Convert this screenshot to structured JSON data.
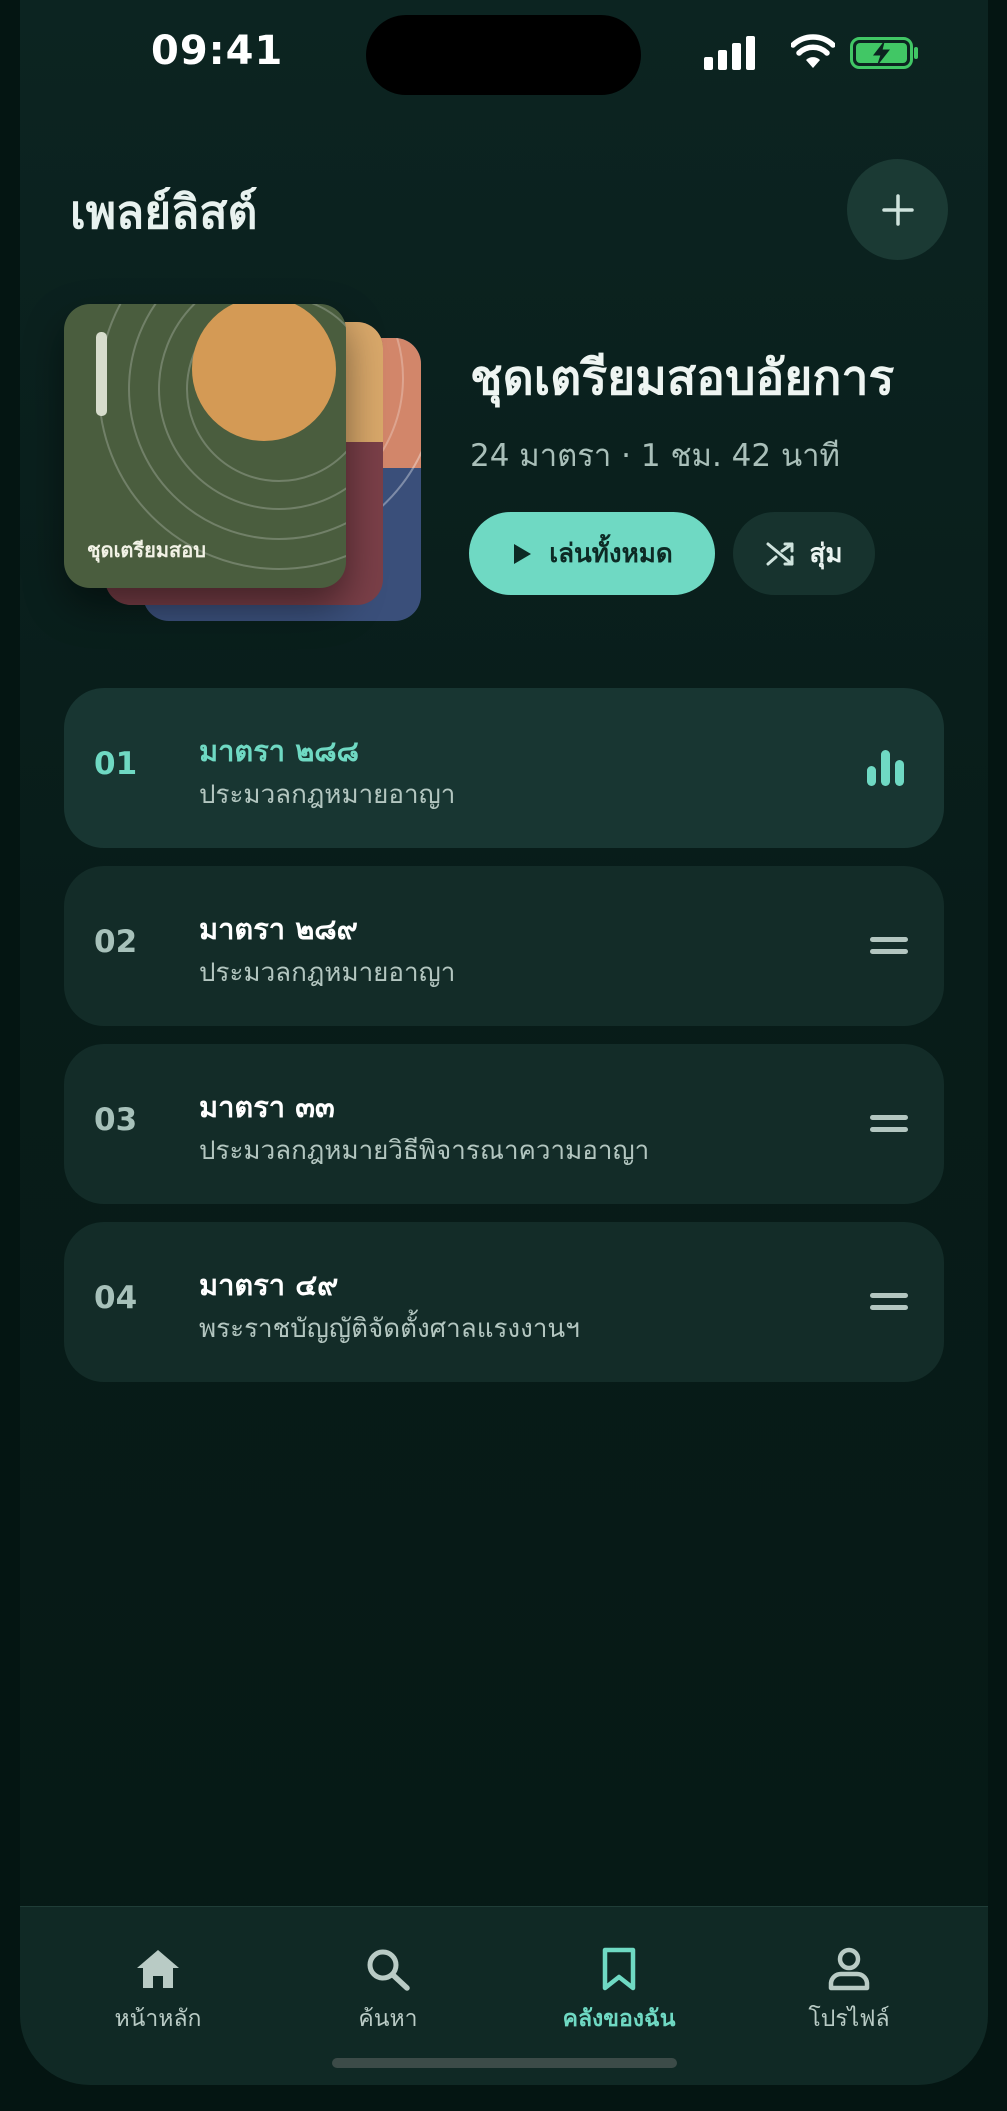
{
  "status_bar": {
    "time": "09:41",
    "icons": [
      "signal-icon",
      "wifi-icon",
      "battery-charging-icon"
    ]
  },
  "header": {
    "title": "เพลย์ลิสต์",
    "add_icon": "plus-icon"
  },
  "playlist": {
    "cover_label": "ชุดเตรียมสอบ",
    "name": "ชุดเตรียมสอบอัยการ",
    "meta": "24 มาตรา · 1 ชม. 42 นาที",
    "play_all_label": "เล่นทั้งหมด",
    "shuffle_label": "สุ่ม"
  },
  "tracks": [
    {
      "number": "01",
      "title": "มาตรา ๒๘๘",
      "subtitle": "ประมวลกฎหมายอาญา",
      "state": "playing"
    },
    {
      "number": "02",
      "title": "มาตรา ๒๘๙",
      "subtitle": "ประมวลกฎหมายอาญา",
      "state": "idle"
    },
    {
      "number": "03",
      "title": "มาตรา ๓๓",
      "subtitle": "ประมวลกฎหมายวิธีพิจารณาความอาญา",
      "state": "idle"
    },
    {
      "number": "04",
      "title": "มาตรา ๔๙",
      "subtitle": "พระราชบัญญัติจัดตั้งศาลแรงงานฯ",
      "state": "idle"
    }
  ],
  "nav": {
    "items": [
      {
        "label": "หน้าหลัก",
        "icon": "home-icon"
      },
      {
        "label": "ค้นหา",
        "icon": "search-icon"
      },
      {
        "label": "คลังของฉัน",
        "icon": "bookmark-icon",
        "active": true
      },
      {
        "label": "โปรไฟล์",
        "icon": "profile-icon"
      }
    ]
  },
  "colors": {
    "accent": "#6fd9c3",
    "background": "#081c19",
    "card": "#132c28"
  }
}
